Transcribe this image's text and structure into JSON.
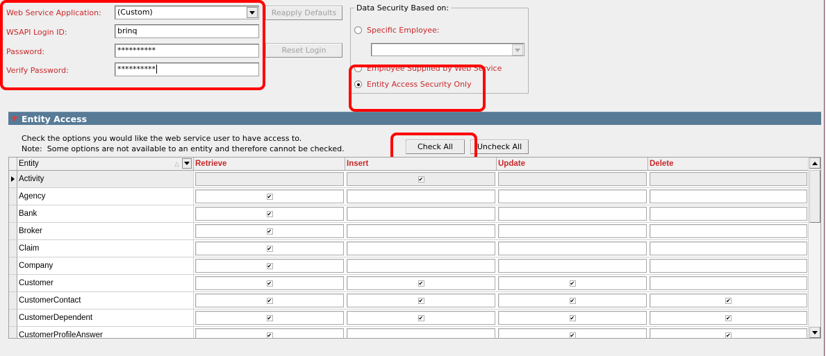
{
  "login": {
    "web_service_app_label": "Web Service Application:",
    "web_service_app_value": "(Custom)",
    "login_id_label": "WSAPI Login ID:",
    "login_id_value": "brinq",
    "password_label": "Password:",
    "password_value": "**********",
    "verify_password_label": "Verify Password:",
    "verify_password_value": "**********",
    "reapply_defaults_label": "Reapply Defaults",
    "reset_login_label": "Reset Login"
  },
  "data_security": {
    "legend": "Data Security Based on:",
    "options": [
      {
        "label": "Specific Employee:",
        "selected": false
      },
      {
        "label": "Employee Supplied by Web Service",
        "selected": false
      },
      {
        "label": "Entity Access Security Only",
        "selected": true
      }
    ],
    "employee_select_value": ""
  },
  "entity_access": {
    "title": "Entity Access",
    "instruction": "Check the options you would like the web service user to have access to.",
    "note": "Note:  Some options are not available to an entity and therefore cannot be checked.",
    "check_all_label": "Check All",
    "uncheck_all_label": "Uncheck All",
    "columns": [
      "Entity",
      "Retrieve",
      "Insert",
      "Update",
      "Delete"
    ],
    "rows": [
      {
        "entity": "Activity",
        "retrieve": false,
        "insert": true,
        "update": false,
        "delete": false,
        "current": true
      },
      {
        "entity": "Agency",
        "retrieve": true,
        "insert": false,
        "update": false,
        "delete": false
      },
      {
        "entity": "Bank",
        "retrieve": true,
        "insert": false,
        "update": false,
        "delete": false
      },
      {
        "entity": "Broker",
        "retrieve": true,
        "insert": false,
        "update": false,
        "delete": false
      },
      {
        "entity": "Claim",
        "retrieve": true,
        "insert": false,
        "update": false,
        "delete": false
      },
      {
        "entity": "Company",
        "retrieve": true,
        "insert": false,
        "update": false,
        "delete": false
      },
      {
        "entity": "Customer",
        "retrieve": true,
        "insert": true,
        "update": true,
        "delete": false
      },
      {
        "entity": "CustomerContact",
        "retrieve": true,
        "insert": true,
        "update": true,
        "delete": true
      },
      {
        "entity": "CustomerDependent",
        "retrieve": true,
        "insert": true,
        "update": true,
        "delete": true
      },
      {
        "entity": "CustomerProfileAnswer",
        "retrieve": true,
        "insert": false,
        "update": true,
        "delete": true
      }
    ]
  }
}
